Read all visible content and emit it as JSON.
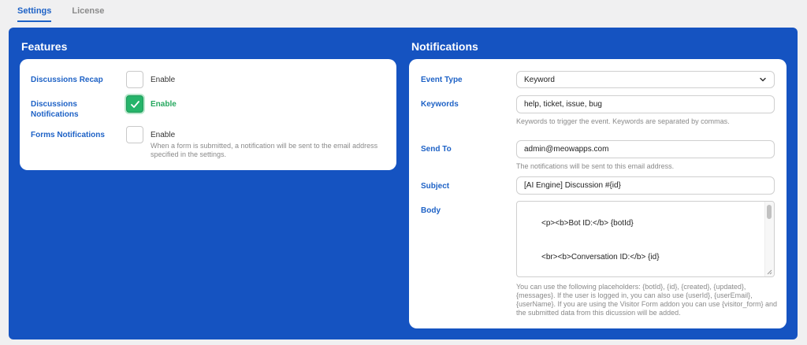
{
  "tabs": [
    {
      "label": "Settings",
      "active": true
    },
    {
      "label": "License",
      "active": false
    }
  ],
  "features": {
    "title": "Features",
    "rows": [
      {
        "label": "Discussions Recap",
        "checked": false,
        "enable_label": "Enable"
      },
      {
        "label": "Discussions Notifications",
        "checked": true,
        "enable_label": "Enable"
      },
      {
        "label": "Forms Notifications",
        "checked": false,
        "enable_label": "Enable",
        "help": "When a form is submitted, a notification will be sent to the email address specified in the settings."
      }
    ]
  },
  "notifications": {
    "title": "Notifications",
    "event_type": {
      "label": "Event Type",
      "value": "Keyword"
    },
    "keywords": {
      "label": "Keywords",
      "value": "help, ticket, issue, bug",
      "help": "Keywords to trigger the event. Keywords are separated by commas."
    },
    "send_to": {
      "label": "Send To",
      "value": "admin@meowapps.com",
      "help": "The notifications will be sent to this email address."
    },
    "subject": {
      "label": "Subject",
      "value": "[AI Engine] Discussion #{id}"
    },
    "body": {
      "label": "Body",
      "lines": [
        "<p><b>Bot ID:</b> {botId}",
        "<br><b>Conversation ID:</b> {id}"
      ],
      "help": "You can use the following placeholders: {botId}, {id}, {created}, {updated}, {messages}. If the user is logged in, you can also use {userId}, {userEmail}, {userName}. If you are using the Visitor Form addon you can use {visitor_form} and the submitted data from this dicussion will be added."
    }
  },
  "colors": {
    "accent": "#1e62c6",
    "panel": "#1553c1",
    "success": "#26b46a"
  }
}
